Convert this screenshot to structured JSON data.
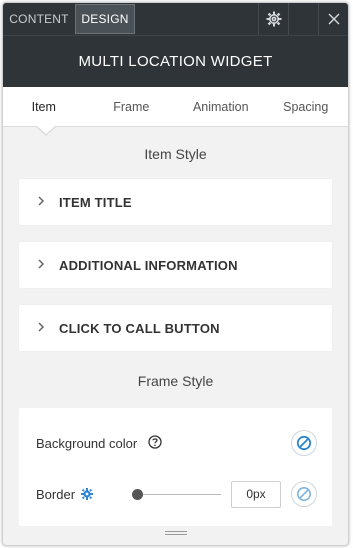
{
  "topbar": {
    "content_tab": "CONTENT",
    "design_tab": "DESIGN",
    "settings_icon": "gear-icon",
    "blank_icon": "",
    "close_icon": "close-icon"
  },
  "header": {
    "title": "MULTI LOCATION WIDGET"
  },
  "subtabs": [
    {
      "label": "Item"
    },
    {
      "label": "Frame"
    },
    {
      "label": "Animation"
    },
    {
      "label": "Spacing"
    }
  ],
  "item_style": {
    "heading": "Item Style",
    "sections": [
      {
        "label": "ITEM TITLE"
      },
      {
        "label": "ADDITIONAL INFORMATION"
      },
      {
        "label": "CLICK TO CALL BUTTON"
      }
    ]
  },
  "frame_style": {
    "heading": "Frame Style",
    "background_color_label": "Background color",
    "border_label": "Border",
    "border_value": "0px",
    "border_slider_level": 0
  },
  "colors": {
    "header_bg": "#2f3438",
    "accent_blue": "#2e86d1",
    "panel_bg": "#f2f2f2"
  }
}
